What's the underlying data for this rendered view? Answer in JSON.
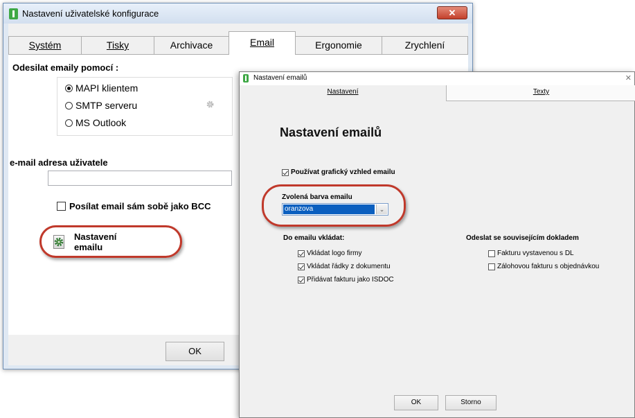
{
  "back_window": {
    "title": "Nastavení uživatelské konfigurace",
    "close_glyph": "✕",
    "tabs": [
      {
        "label": "Systém"
      },
      {
        "label": "Tisky"
      },
      {
        "label": "Archivace"
      },
      {
        "label": "Email"
      },
      {
        "label": "Ergonomie"
      },
      {
        "label": "Zrychlení"
      }
    ],
    "active_tab": "Email",
    "send_label": "Odesilat emaily pomocí :",
    "send_options": [
      {
        "label": "MAPI klientem",
        "selected": true
      },
      {
        "label": "SMTP serveru",
        "selected": false
      },
      {
        "label": "MS Outlook",
        "selected": false
      }
    ],
    "email_label": "e-mail adresa uživatele",
    "email_value": "",
    "bcc_label": "Posílat email sám sobě jako BCC",
    "bcc_checked": false,
    "email_settings_button": "Nastavení emailu",
    "ok_label": "OK"
  },
  "front_window": {
    "title": "Nastavení emailů",
    "close_glyph": "✕",
    "tabs": [
      {
        "label": "Nastavení"
      },
      {
        "label": "Texty"
      }
    ],
    "heading": "Nastavení emailů",
    "use_graphic_label": "Používat grafický vzhled emailu",
    "use_graphic_checked": true,
    "color_label": "Zvolená barva emailu",
    "color_value": "oranzova",
    "insert_label": "Do emailu vkládat:",
    "insert_options": [
      {
        "label": "Vkládat logo firmy",
        "checked": true
      },
      {
        "label": "Vkládat řádky z dokumentu",
        "checked": true
      },
      {
        "label": "Přidávat fakturu  jako ISDOC",
        "checked": true
      }
    ],
    "related_label": "Odeslat se souvisejícím dokladem",
    "related_options": [
      {
        "label": "Fakturu vystavenou s DL",
        "checked": false
      },
      {
        "label": "Zálohovou fakturu s objednávkou",
        "checked": false
      }
    ],
    "ok_label": "OK",
    "cancel_label": "Storno"
  },
  "colors": {
    "highlight_ring": "#c0392b",
    "app_icon": "#3ea845",
    "selection": "#0b5fbf"
  }
}
